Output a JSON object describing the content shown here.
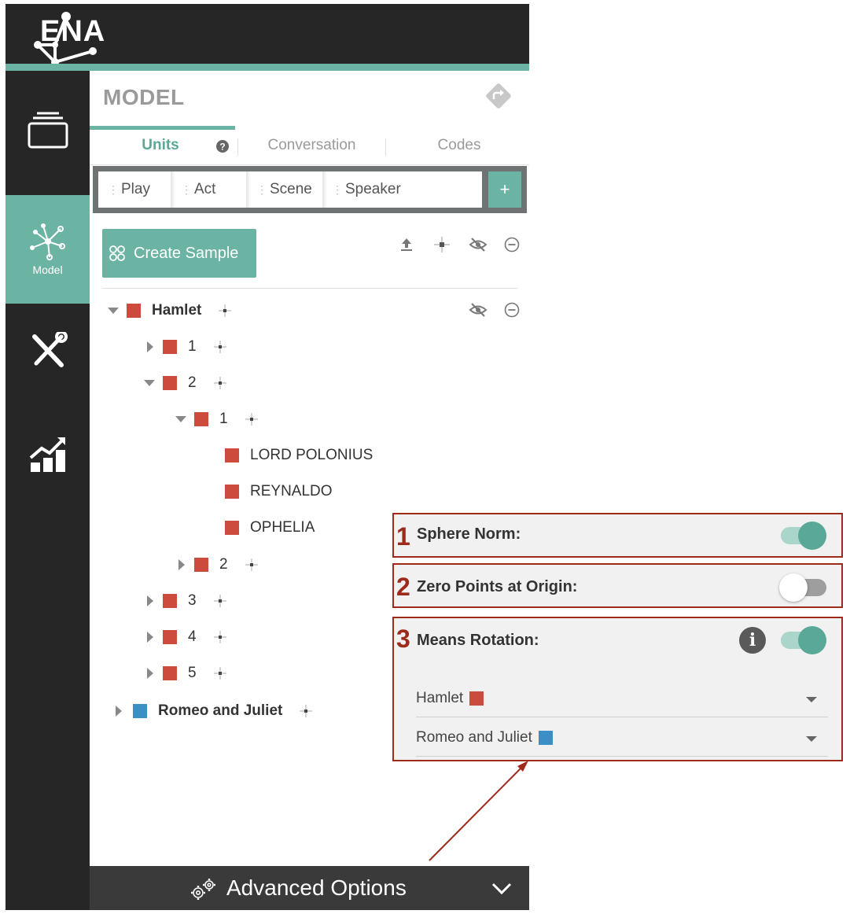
{
  "app": {
    "logo_text": "ENA"
  },
  "nav": {
    "model_label": "Model"
  },
  "panel": {
    "title": "MODEL",
    "tabs": [
      {
        "label": "Units"
      },
      {
        "label": "Conversation"
      },
      {
        "label": "Codes"
      }
    ],
    "help_glyph": "?",
    "units": [
      "Play",
      "Act",
      "Scene",
      "Speaker"
    ],
    "add_glyph": "+",
    "create_sample_label": "Create Sample"
  },
  "tree": [
    {
      "label": "Hamlet",
      "color": "#cc4b3c"
    },
    {
      "label": "1",
      "color": "#cc4b3c"
    },
    {
      "label": "2",
      "color": "#cc4b3c"
    },
    {
      "label": "1",
      "color": "#cc4b3c"
    },
    {
      "label": "LORD POLONIUS",
      "color": "#cc4b3c"
    },
    {
      "label": "REYNALDO",
      "color": "#cc4b3c"
    },
    {
      "label": "OPHELIA",
      "color": "#cc4b3c"
    },
    {
      "label": "2",
      "color": "#cc4b3c"
    },
    {
      "label": "3",
      "color": "#cc4b3c"
    },
    {
      "label": "4",
      "color": "#cc4b3c"
    },
    {
      "label": "5",
      "color": "#cc4b3c"
    },
    {
      "label": "Romeo and Juliet",
      "color": "#3b8fc4"
    }
  ],
  "advanced": {
    "label": "Advanced Options"
  },
  "options": {
    "sphere_norm": {
      "number": "1",
      "label": "Sphere Norm:",
      "enabled": true
    },
    "zero_points": {
      "number": "2",
      "label": "Zero Points at Origin:",
      "enabled": false
    },
    "means_rotation": {
      "number": "3",
      "label": "Means Rotation:",
      "enabled": true,
      "info_glyph": "i",
      "selects": [
        {
          "label": "Hamlet",
          "color": "#cc4b3c"
        },
        {
          "label": "Romeo and Juliet",
          "color": "#3b8fc4"
        }
      ]
    }
  },
  "colors": {
    "accent": "#6bb3a3",
    "annotation": "#9e2a1c",
    "dark": "#262626"
  }
}
